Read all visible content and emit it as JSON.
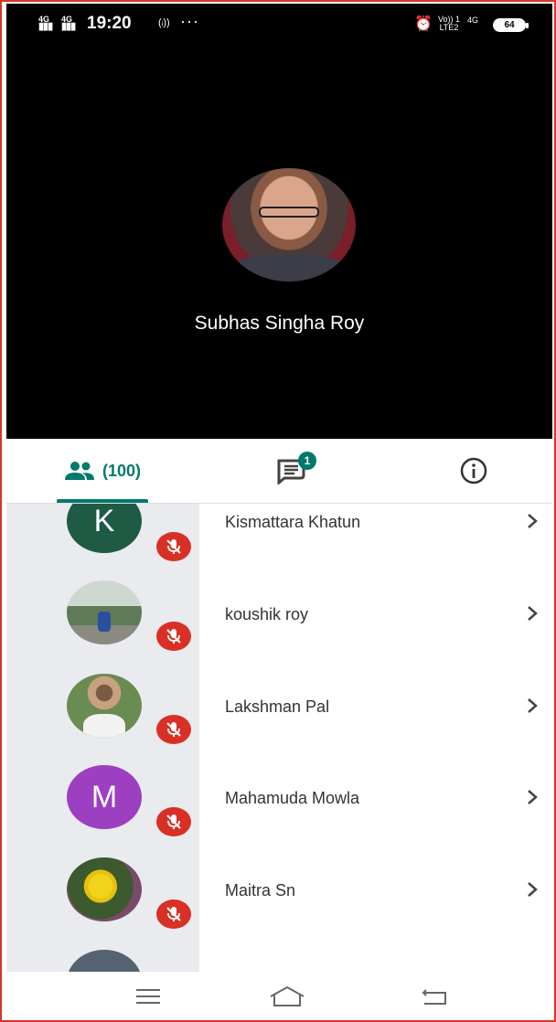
{
  "status_bar": {
    "sim1": "4G",
    "sim2": "4G",
    "time": "19:20",
    "volte_top": "Vo)) 1",
    "volte_bottom": "LTE2",
    "net2": "4G",
    "battery": "64",
    "icons": [
      "signal-icon",
      "signal-icon",
      "nfc-icon",
      "more-dots-icon",
      "alarm-icon",
      "battery-icon"
    ]
  },
  "call": {
    "host_name": "Subhas Singha Roy"
  },
  "tabs": {
    "people_count": "(100)",
    "chat_badge": "1",
    "icons": [
      "people-icon",
      "chat-icon",
      "info-icon"
    ],
    "accent": "#00796b"
  },
  "participants": [
    {
      "name": "Kismattara Khatun",
      "initial": "K",
      "avatar_color": "#1f5a45",
      "muted": true
    },
    {
      "name": "koushik roy",
      "initial": "",
      "avatar_color": "#7e8f7a",
      "muted": true
    },
    {
      "name": "Lakshman Pal",
      "initial": "",
      "avatar_color": "#6a8b52",
      "muted": true
    },
    {
      "name": "Mahamuda Mowla",
      "initial": "M",
      "avatar_color": "#9c3fc1",
      "muted": true
    },
    {
      "name": "Maitra Sn",
      "initial": "",
      "avatar_color": "#3c5a2e",
      "muted": true
    }
  ],
  "colors": {
    "mute": "#d93025",
    "stage": "#000000"
  },
  "navbar": {
    "icons": [
      "menu-icon",
      "home-icon",
      "back-icon"
    ]
  }
}
